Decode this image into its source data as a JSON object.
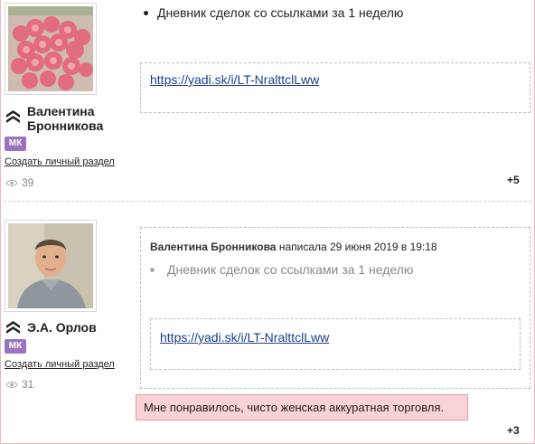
{
  "posts": [
    {
      "author": "Валентина Бронникова",
      "author_line1": "Валентина",
      "author_line2": "Бронникова",
      "badge": "МК",
      "create_link": "Создать личный раздел",
      "views": "39",
      "bullet": "Дневник сделок со ссылками за 1 неделю",
      "link": "https://yadi.sk/i/LT-NralttclLww",
      "plus": "+5",
      "avatar_icon": "roses-photo"
    },
    {
      "author": "Э.А. Орлов",
      "badge": "МК",
      "create_link": "Создать личный раздел",
      "views": "31",
      "quote": {
        "author": "Валентина Бронникова",
        "meta": "написала 29 июня 2019 в 19:18",
        "bullet": "Дневник сделок со ссылками за 1 неделю",
        "link": "https://yadi.sk/i/LT-NralttclLww"
      },
      "highlight": "Мне понравилось, чисто женская аккуратная торговля.",
      "plus": "+3",
      "avatar_icon": "man-portrait-photo"
    }
  ],
  "colors": {
    "badge": "#9b74bd",
    "link": "#1a3e8c",
    "highlight_bg": "#f7d3d7",
    "highlight_border": "#e79aa4",
    "frame": "#e8b7c0"
  }
}
